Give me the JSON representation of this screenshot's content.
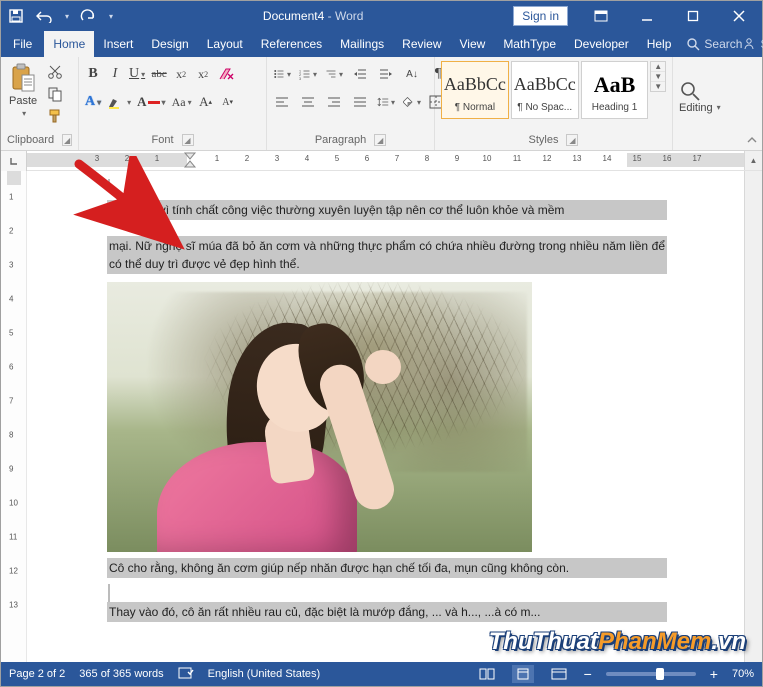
{
  "title": {
    "doc": "Document4",
    "app": "Word",
    "sep": " - "
  },
  "signin": "Sign in",
  "tabs": [
    "File",
    "Home",
    "Insert",
    "Design",
    "Layout",
    "References",
    "Mailings",
    "Review",
    "View",
    "MathType",
    "Developer",
    "Help"
  ],
  "active_tab": "Home",
  "tell_me": "Search",
  "share": "Share",
  "groups": {
    "clipboard": "Clipboard",
    "font": "Font",
    "paragraph": "Paragraph",
    "styles": "Styles",
    "editing": "Editing"
  },
  "paste": "Paste",
  "styles_gallery": [
    {
      "preview": "AaBbCc",
      "name": "¶ Normal"
    },
    {
      "preview": "AaBbCc",
      "name": "¶ No Spac..."
    },
    {
      "preview": "AaB",
      "name": "Heading 1"
    }
  ],
  "editing_label": "Editing",
  "ruler_h_numbers": [
    "3",
    "2",
    "1",
    "1",
    "2",
    "3",
    "4",
    "5",
    "6",
    "7",
    "8",
    "9",
    "10",
    "11",
    "12",
    "13",
    "14",
    "15",
    "16",
    "17"
  ],
  "ruler_v_numbers": [
    "1",
    "2",
    "3",
    "4",
    "5",
    "6",
    "7",
    "8",
    "9",
    "10",
    "11",
    "12",
    "13"
  ],
  "document": {
    "p1": "Cô tiết lộ vì tính chất công việc thường xuyên luyện tập nên cơ thể luôn khỏe và mềm",
    "p2": "mại. Nữ nghệ sĩ múa đã bỏ ăn cơm và những thực phẩm có chứa nhiều đường trong nhiều năm liền để có thể duy trì được vẻ đẹp hình thể.",
    "p3": "Cô cho rằng, không ăn cơm giúp nếp nhăn được hạn chế tối đa, mụn cũng không còn.",
    "p4": "Thay vào đó, cô ăn rất nhiều rau củ, đặc biệt là mướp đắng, ... và h..., ...à có m..."
  },
  "status": {
    "page": "Page 2 of 2",
    "words": "365 of 365 words",
    "lang": "English (United States)",
    "zoom": "70%"
  },
  "watermark": {
    "a": "ThuThuat",
    "b": "PhanMem",
    "c": ".vn"
  }
}
